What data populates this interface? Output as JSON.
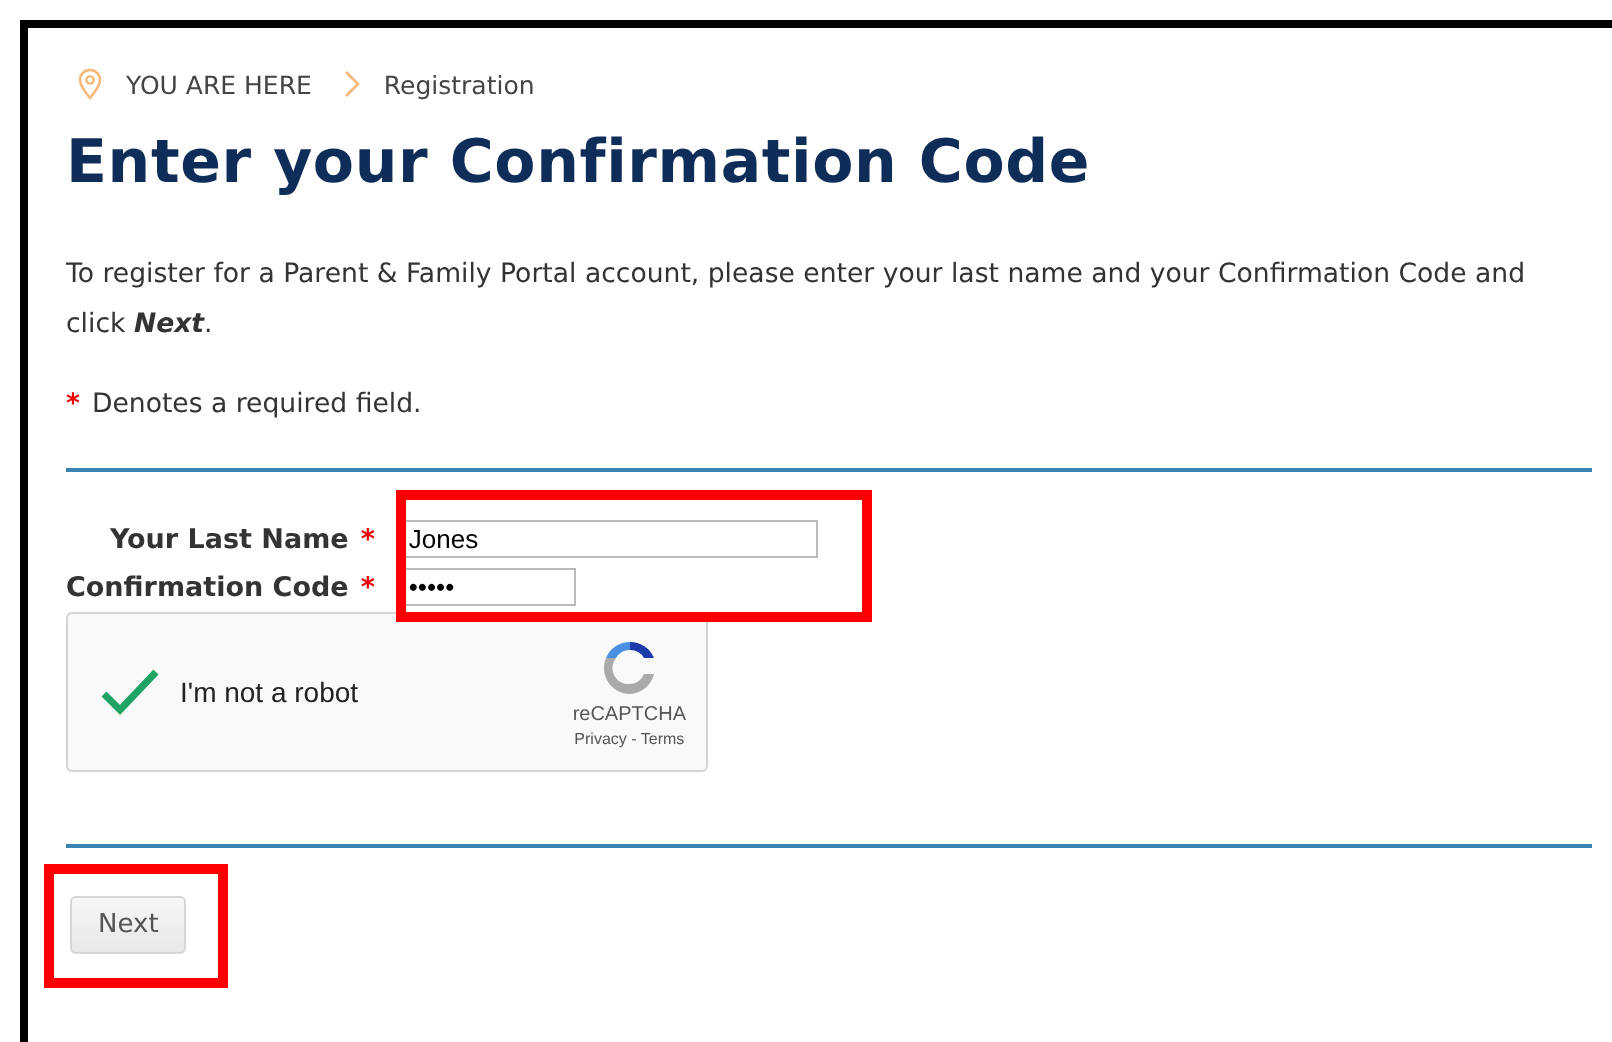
{
  "breadcrumb": {
    "label": "YOU ARE HERE",
    "current": "Registration"
  },
  "title": "Enter your Confirmation Code",
  "intro": "To register for a Parent & Family Portal account, please enter your last name and your Confirmation Code and click **Next**.",
  "required_mark": "*",
  "required_note": "Denotes a required field.",
  "fields": [
    {
      "label": "Your Last Name",
      "value": "Jones",
      "kind": "wide"
    },
    {
      "label": "Confirmation Code",
      "value": "•••••",
      "kind": "narrow"
    }
  ],
  "captcha": {
    "label": "I'm not a robot",
    "checked": true,
    "brand": "reCAPTCHA",
    "links": "Privacy - Terms"
  },
  "buttons": [
    "Next"
  ]
}
